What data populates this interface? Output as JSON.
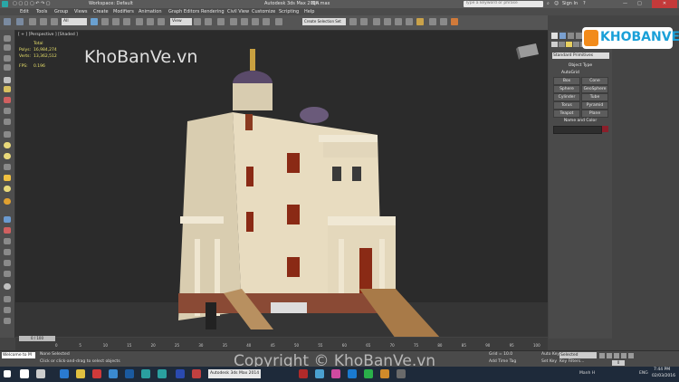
{
  "window": {
    "workspace_label": "Workspace: Default",
    "app_title": "Autodesk 3ds Max 2014",
    "file_name": "Bjh.max",
    "search_placeholder": "Type a keyword or phrase",
    "sign_in": "Sign In"
  },
  "menu": [
    "Edit",
    "Tools",
    "Group",
    "Views",
    "Create",
    "Modifiers",
    "Animation",
    "Graph Editors",
    "Rendering",
    "Civil View",
    "Customize",
    "Scripting",
    "Help"
  ],
  "toolbar": {
    "selection_filter": "All",
    "ref_coord": "View",
    "named_selection": "Create Selection Set"
  },
  "viewport": {
    "label": "[ + ] [Perspective ] [Shaded ]",
    "stats": {
      "total_label": "Total",
      "polys_label": "Polys:",
      "polys_value": "16,984,274",
      "verts_label": "Verts:",
      "verts_value": "13,362,512",
      "fps_label": "FPS:",
      "fps_value": "0.196"
    }
  },
  "command_panel": {
    "category": "Standard Primitives",
    "rollout_object_type": "Object Type",
    "autogrid": "AutoGrid",
    "buttons": [
      "Box",
      "Cone",
      "Sphere",
      "GeoSphere",
      "Cylinder",
      "Tube",
      "Torus",
      "Pyramid",
      "Teapot",
      "Plane"
    ],
    "rollout_name_color": "Name and Color",
    "color_swatch": "#8a1f2a"
  },
  "timeline": {
    "frame_counter": "0 / 100",
    "ticks": [
      "0",
      "5",
      "10",
      "15",
      "20",
      "25",
      "30",
      "35",
      "40",
      "45",
      "50",
      "55",
      "60",
      "65",
      "70",
      "75",
      "80",
      "85",
      "90",
      "95",
      "100"
    ]
  },
  "status": {
    "selection": "None Selected",
    "prompt": "Click or click-and-drag to select objects",
    "listener": "Welcome to M",
    "grid": "Grid = 10.0",
    "autokey": "Auto Key",
    "selected": "Selected",
    "setkey": "Set Key",
    "keyfilters": "Key Filters...",
    "add_time_tag": "Add Time Tag",
    "frame": "0"
  },
  "taskbar": {
    "search_text": "Autodesk 3ds Max 2014",
    "user": "Manh H",
    "lang": "ENG",
    "time": "7:44 PM",
    "date": "02/03/2016"
  },
  "brand": {
    "logo_text": "KHOBANVE",
    "watermark_top": "KhoBanVe.vn",
    "watermark_bottom": "Copyright © KhoBanVe.vn"
  },
  "colors": {
    "accent": "#e8e06a",
    "taskbar": "#1e2a3a",
    "logo_blue": "#1aa0d8",
    "logo_orange": "#f28b1b"
  }
}
